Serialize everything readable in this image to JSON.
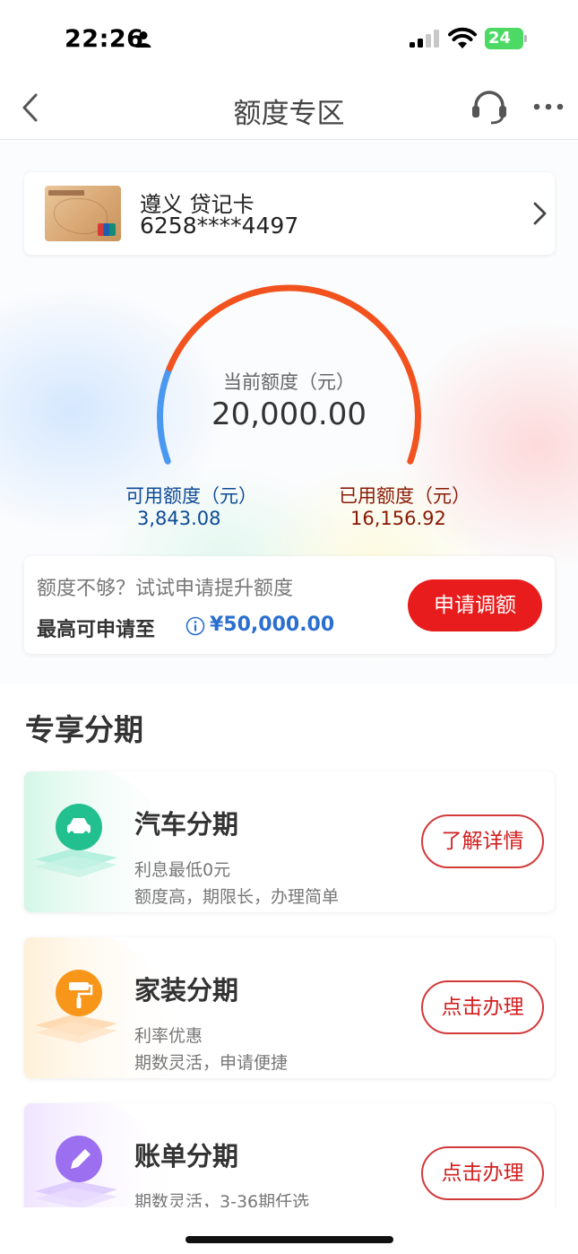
{
  "status_bar": {
    "time": "22:26",
    "battery": "24"
  },
  "nav": {
    "title": "额度专区"
  },
  "card": {
    "name": "遵义 贷记卡",
    "number": "6258****4497"
  },
  "gauge": {
    "label": "当前额度（元）",
    "total": "20,000.00",
    "available_label": "可用额度（元）",
    "available_value": "3,843.08",
    "used_label": "已用额度（元）",
    "used_value": "16,156.92",
    "available_fraction": 0.192,
    "colors": {
      "available": "#4a98f0",
      "used": "#f2531e"
    }
  },
  "limit": {
    "hint": "额度不够？试试申请提升额度",
    "max_label": "最高可申请至",
    "max_amount": "¥50,000.00",
    "apply_label": "申请调额"
  },
  "section": {
    "title": "专享分期"
  },
  "installments": [
    {
      "title": "汽车分期",
      "line1": "利息最低0元",
      "line2": "额度高，期限长，办理简单",
      "button": "了解详情",
      "icon": "car-icon",
      "color": "#2dc795"
    },
    {
      "title": "家装分期",
      "line1": "利率优惠",
      "line2": "期数灵活，申请便捷",
      "button": "点击办理",
      "icon": "paint-roller-icon",
      "color": "#fa9a1a"
    },
    {
      "title": "账单分期",
      "line1": "期数灵活，3-36期任选",
      "line2": "",
      "button": "点击办理",
      "icon": "pencil-icon",
      "color": "#9b6ff0"
    }
  ]
}
